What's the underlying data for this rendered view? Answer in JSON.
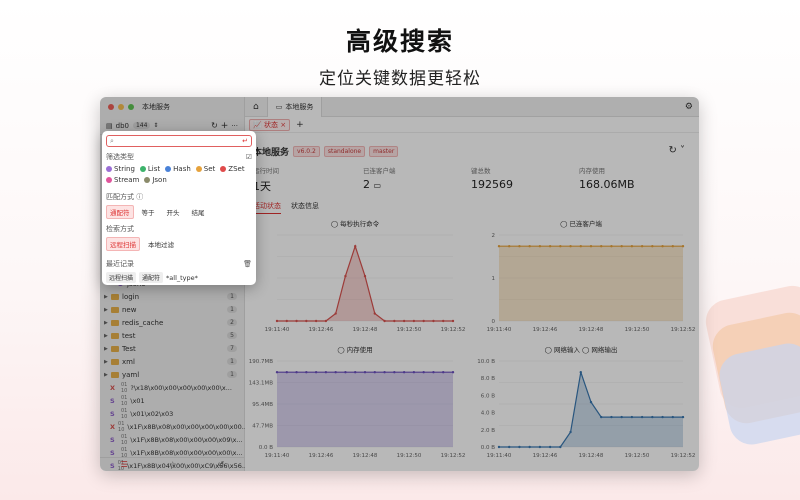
{
  "hero": {
    "title": "高级搜索",
    "subtitle": "定位关键数据更轻松"
  },
  "window": {
    "title": "本地服务",
    "db": {
      "name": "db0",
      "count": "144"
    },
    "tabs": [
      {
        "label": "本地服务"
      },
      {
        "label": "状态"
      }
    ],
    "server": {
      "name": "本地服务",
      "tags": [
        "v6.0.2",
        "standalone",
        "master"
      ]
    },
    "stats": [
      {
        "label": "运行时间",
        "value": "1天"
      },
      {
        "label": "已连客户端",
        "value": "2"
      },
      {
        "label": "键总数",
        "value": "192569"
      },
      {
        "label": "内存使用",
        "value": "168.06MB"
      }
    ],
    "subtabs": [
      "活动状态",
      "状态信息"
    ],
    "tree": [
      {
        "name": "json5",
        "count": ""
      },
      {
        "name": "login",
        "count": "1"
      },
      {
        "name": "new",
        "count": "1"
      },
      {
        "name": "redis_cache",
        "count": "2"
      },
      {
        "name": "test",
        "count": "5"
      },
      {
        "name": "Test",
        "count": "7"
      },
      {
        "name": "xml",
        "count": "1"
      },
      {
        "name": "yaml",
        "count": "1"
      }
    ],
    "keys": [
      {
        "type": "X",
        "color": "#d9534f",
        "name": "?\\x18\\x00\\x00\\x00\\x00\\x00\\x..."
      },
      {
        "type": "S",
        "color": "#8e5fc9",
        "name": "\\x01"
      },
      {
        "type": "S",
        "color": "#8e5fc9",
        "name": "\\x01\\x02\\x03"
      },
      {
        "type": "X",
        "color": "#d9534f",
        "name": "\\x1F\\x8B\\x08\\x00\\x00\\x00\\x00\\x00..."
      },
      {
        "type": "S",
        "color": "#8e5fc9",
        "name": "\\x1F\\x8B\\x08\\x00\\x00\\x00\\x09\\x..."
      },
      {
        "type": "S",
        "color": "#8e5fc9",
        "name": "\\x1F\\x8B\\x08\\x00\\x00\\x00\\x00\\x..."
      },
      {
        "type": "S",
        "color": "#8e5fc9",
        "name": "\\x1F\\x8B\\x04\\x00\\x00\\xC9\\x56\\x56..."
      }
    ]
  },
  "popup": {
    "placeholder": "",
    "filter_label": "筛选类型",
    "types": [
      {
        "name": "String",
        "color": "#9b6fd6"
      },
      {
        "name": "List",
        "color": "#3db36b"
      },
      {
        "name": "Hash",
        "color": "#4a82d8"
      },
      {
        "name": "Set",
        "color": "#e6a23c"
      },
      {
        "name": "ZSet",
        "color": "#e04b4b"
      },
      {
        "name": "Stream",
        "color": "#e0559c"
      },
      {
        "name": "Json",
        "color": "#8b8b6b"
      }
    ],
    "match_label": "匹配方式",
    "match_options": [
      "通配符",
      "等于",
      "开头",
      "结尾"
    ],
    "search_label": "检索方式",
    "search_options": [
      "远程扫描",
      "本地过滤"
    ],
    "recent_label": "最近记录",
    "recent_chips": [
      "远程扫描",
      "通配符"
    ],
    "recent_query": "*all_type*"
  },
  "charts": [
    {
      "type": "area",
      "title": "每秒执行命令",
      "color": "#d9534f",
      "x": [
        "19:11:40",
        "19:12:46",
        "19:12:48",
        "19:12:50",
        "19:12:52"
      ],
      "y": [
        0,
        0,
        0,
        0,
        0,
        0,
        0.5,
        3,
        5,
        3,
        0.5,
        0,
        0,
        0,
        0,
        0,
        0,
        0,
        0
      ],
      "yticks": []
    },
    {
      "type": "area",
      "title": "已连客户端",
      "color": "#e6a23c",
      "x": [
        "19:11:40",
        "19:12:46",
        "19:12:48",
        "19:12:50",
        "19:12:52"
      ],
      "y": [
        2,
        2,
        2,
        2,
        2,
        2,
        2,
        2,
        2,
        2,
        2,
        2,
        2,
        2,
        2,
        2,
        2,
        2,
        2
      ],
      "yticks": [
        "2",
        "1",
        "0"
      ]
    },
    {
      "type": "area",
      "title": "内存使用",
      "color": "#6b4fbf",
      "x": [
        "19:11:40",
        "19:12:46",
        "19:12:48",
        "19:12:50",
        "19:12:52"
      ],
      "y": [
        168,
        168,
        168,
        168,
        168,
        168,
        168,
        168,
        168,
        168,
        168,
        168,
        168,
        168,
        168,
        168,
        168,
        168,
        168
      ],
      "yticks": [
        "190.7MB",
        "143.1MB",
        "95.4MB",
        "47.7MB",
        "0.0 B"
      ]
    },
    {
      "type": "area",
      "title": "网络输入",
      "title2": "网络输出",
      "color": "#3a78b0",
      "x": [
        "19:11:40",
        "19:12:46",
        "19:12:48",
        "19:12:50",
        "19:12:52"
      ],
      "y": [
        0,
        0,
        0,
        0,
        0,
        0,
        0,
        2,
        10,
        6,
        4,
        4,
        4,
        4,
        4,
        4,
        4,
        4,
        4
      ],
      "yticks": [
        "10.0 B",
        "8.0 B",
        "6.0 B",
        "4.0 B",
        "2.0 B",
        "0.0 B"
      ]
    }
  ]
}
